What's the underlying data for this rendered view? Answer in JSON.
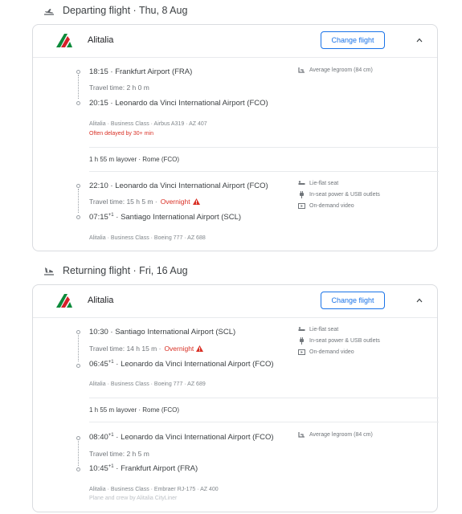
{
  "departing": {
    "title": "Departing flight · Thu, 8 Aug",
    "airline": "Alitalia",
    "change_label": "Change flight",
    "leg1": {
      "dep": "18:15 · Frankfurt Airport (FRA)",
      "travel": "Travel time: 2 h 0 m",
      "arr": "20:15 · Leonardo da Vinci International Airport (FCO)",
      "details": "Alitalia · Business Class · Airbus A319 · AZ 407",
      "delay": "Often delayed by 30+ min",
      "amenities": [
        {
          "icon": "legroom-icon",
          "label": "Average legroom (84 cm)"
        }
      ]
    },
    "layover": "1 h 55 m layover · Rome (FCO)",
    "leg2": {
      "dep": "22:10 · Leonardo da Vinci International Airport (FCO)",
      "travel": "Travel time: 15 h 5 m ·",
      "overnight": "Overnight",
      "arr_time": "07:15",
      "arr_sup": "+1",
      "arr_place": " · Santiago International Airport (SCL)",
      "details": "Alitalia · Business Class · Boeing 777 · AZ 688",
      "amenities": [
        {
          "icon": "lie-flat-seat-icon",
          "label": "Lie-flat seat"
        },
        {
          "icon": "power-plug-icon",
          "label": "In-seat power & USB outlets"
        },
        {
          "icon": "video-icon",
          "label": "On-demand video"
        }
      ]
    }
  },
  "returning": {
    "title": "Returning flight · Fri, 16 Aug",
    "airline": "Alitalia",
    "change_label": "Change flight",
    "leg1": {
      "dep": "10:30 · Santiago International Airport (SCL)",
      "travel": "Travel time: 14 h 15 m ·",
      "overnight": "Overnight",
      "arr_time": "06:45",
      "arr_sup": "+1",
      "arr_place": " · Leonardo da Vinci International Airport (FCO)",
      "details": "Alitalia · Business Class · Boeing 777 · AZ 689",
      "amenities": [
        {
          "icon": "lie-flat-seat-icon",
          "label": "Lie-flat seat"
        },
        {
          "icon": "power-plug-icon",
          "label": "In-seat power & USB outlets"
        },
        {
          "icon": "video-icon",
          "label": "On-demand video"
        }
      ]
    },
    "layover": "1 h 55 m layover · Rome (FCO)",
    "leg2": {
      "dep_time": "08:40",
      "dep_sup": "+1",
      "dep_place": " · Leonardo da Vinci International Airport (FCO)",
      "travel": "Travel time: 2 h 5 m",
      "arr_time": "10:45",
      "arr_sup": "+1",
      "arr_place": " · Frankfurt Airport (FRA)",
      "details": "Alitalia · Business Class · Embraer RJ-175 · AZ 400",
      "operated": "Plane and crew by Alitalia CityLiner",
      "amenities": [
        {
          "icon": "legroom-icon",
          "label": "Average legroom (84 cm)"
        }
      ]
    }
  },
  "colors": {
    "accent": "#1a73e8",
    "warning": "#d93025",
    "logo_green": "#0b8a3a",
    "logo_red": "#d6202a"
  }
}
